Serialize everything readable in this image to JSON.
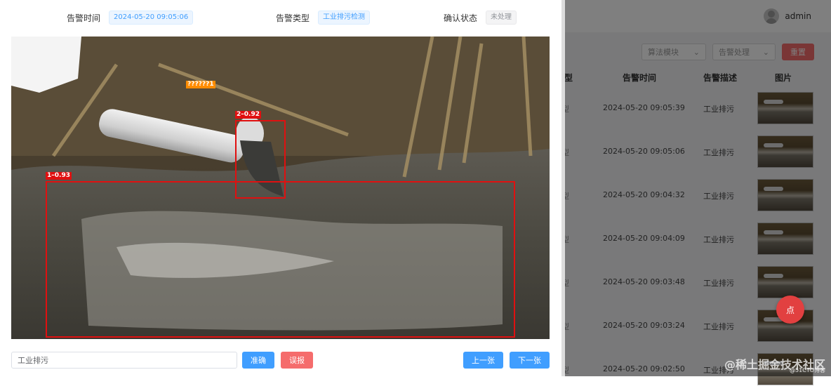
{
  "background": {
    "header": {
      "username": "admin"
    },
    "filters": [
      {
        "label": "算法模块"
      },
      {
        "label": "告警处理"
      }
    ],
    "reset_label": "重置",
    "table": {
      "headers": [
        "型",
        "告警时间",
        "告警描述",
        "图片"
      ],
      "rows": [
        {
          "type": "型",
          "time": "2024-05-20 09:05:39",
          "desc": "工业排污"
        },
        {
          "type": "型",
          "time": "2024-05-20 09:05:06",
          "desc": "工业排污"
        },
        {
          "type": "型",
          "time": "2024-05-20 09:04:32",
          "desc": "工业排污"
        },
        {
          "type": "型",
          "time": "2024-05-20 09:04:09",
          "desc": "工业排污"
        },
        {
          "type": "型",
          "time": "2024-05-20 09:03:48",
          "desc": "工业排污"
        },
        {
          "type": "型",
          "time": "2024-05-20 09:03:24",
          "desc": "工业排污"
        },
        {
          "type": "型",
          "time": "2024-05-20 09:02:50",
          "desc": "工业排污"
        }
      ]
    },
    "float_button_label": "点",
    "watermark": "@稀土掘金技术社区",
    "watermark_sub": "@51CTO博客"
  },
  "dialog": {
    "alarm_time_label": "告警时间",
    "alarm_time_value": "2024-05-20 09:05:06",
    "alarm_type_label": "告警类型",
    "alarm_type_value": "工业排污检测",
    "confirm_status_label": "确认状态",
    "confirm_status_value": "未处理",
    "detections": [
      {
        "label": "??????1",
        "color": "#ff8c00"
      },
      {
        "label": "2–0.92",
        "color": "#e01010"
      },
      {
        "label": "1–0.93",
        "color": "#e01010"
      }
    ],
    "description_value": "工业排污",
    "accurate_label": "准确",
    "false_alarm_label": "误报",
    "prev_label": "上一张",
    "next_label": "下一张"
  },
  "colors": {
    "primary": "#409eff",
    "danger": "#f56c6c",
    "detection_box": "#e01010"
  }
}
